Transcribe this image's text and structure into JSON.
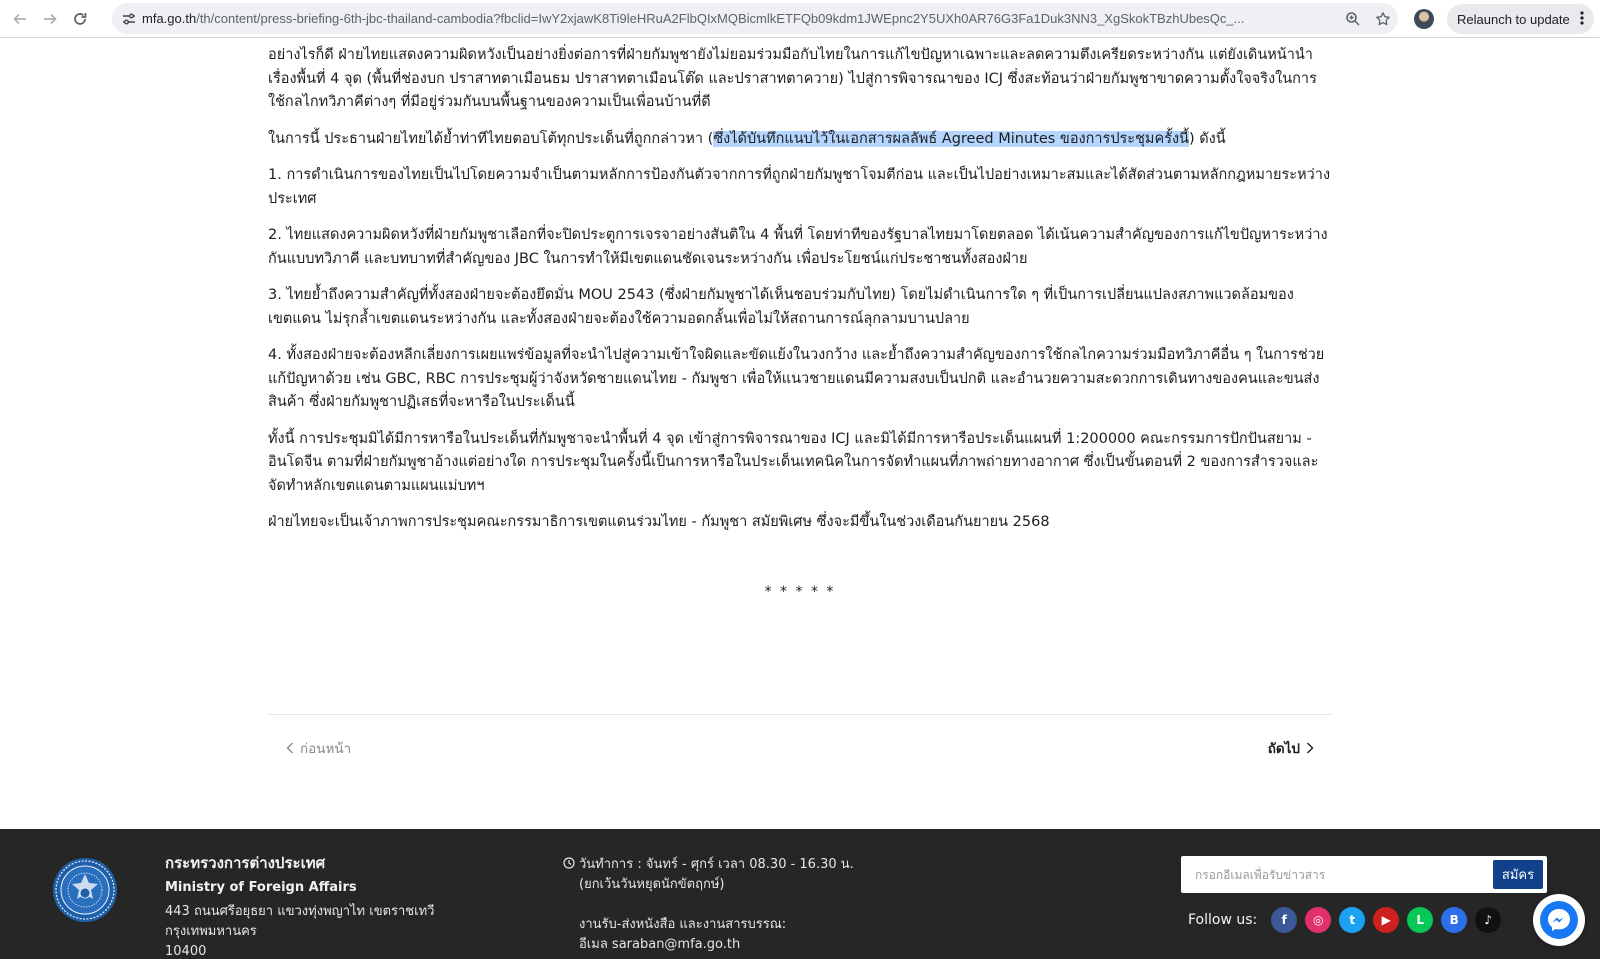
{
  "browser": {
    "url_host": "mfa.go.th",
    "url_path": "/th/content/press-briefing-6th-jbc-thailand-cambodia?fbclid=IwY2xjawK8Ti9leHRuA2FlbQIxMQBicmlkETFQb09kdm1JWEpnc2Y5UXh0AR76G3Fa1Duk3NN3_XgSkokTBzhUbesQc_...",
    "relaunch_label": "Relaunch to update"
  },
  "article": {
    "p_intro": "อย่างไรก็ดี ฝ่ายไทยแสดงความผิดหวังเป็นอย่างยิ่งต่อการที่ฝ่ายกัมพูชายังไม่ยอมร่วมมือกับไทยในการแก้ไขปัญหาเฉพาะและลดความตึงเครียดระหว่างกัน แต่ยังเดินหน้านำเรื่องพื้นที่ 4 จุด (พื้นที่ช่องบก ปราสาทตาเมือนธม ปราสาทตาเมือนโต๊ด และปราสาทตาควาย) ไปสู่การพิจารณาของ ICJ ซึ่งสะท้อนว่าฝ่ายกัมพูชาขาดความตั้งใจจริงในการใช้กลไกทวิภาคีต่างๆ ที่มีอยู่ร่วมกันบนพื้นฐานของความเป็นเพื่อนบ้านที่ดี",
    "p_lead_before": "ในการนี้ ประธานฝ่ายไทยได้ย้ำท่าทีไทยตอบโต้ทุกประเด็นที่ถูกกล่าวหา (",
    "p_lead_highlight": "ซึ่งได้บันทึกแนบไว้ในเอกสารผลลัพธ์ Agreed Minutes ของการประชุมครั้งนี้",
    "p_lead_after": ") ดังนี้",
    "items": [
      "1. การดำเนินการของไทยเป็นไปโดยความจำเป็นตามหลักการป้องกันตัวจากการที่ถูกฝ่ายกัมพูชาโจมตีก่อน และเป็นไปอย่างเหมาะสมและได้สัดส่วนตามหลักกฎหมายระหว่างประเทศ",
      "2. ไทยแสดงความผิดหวังที่ฝ่ายกัมพูชาเลือกที่จะปิดประตูการเจรจาอย่างสันติใน 4 พื้นที่ โดยท่าทีของรัฐบาลไทยมาโดยตลอด ได้เน้นความสำคัญของการแก้ไขปัญหาระหว่างกันแบบทวิภาคี และบทบาทที่สำคัญของ JBC ในการทำให้มีเขตแดนชัดเจนระหว่างกัน เพื่อประโยชน์แก่ประชาชนทั้งสองฝ่าย",
      "3. ไทยย้ำถึงความสำคัญที่ทั้งสองฝ่ายจะต้องยึดมั่น MOU 2543 (ซึ่งฝ่ายกัมพูชาได้เห็นชอบร่วมกับไทย) โดยไม่ดำเนินการใด ๆ ที่เป็นการเปลี่ยนแปลงสภาพแวดล้อมของเขตแดน ไม่รุกล้ำเขตแดนระหว่างกัน และทั้งสองฝ่ายจะต้องใช้ความอดกลั้นเพื่อไม่ให้สถานการณ์ลุกลามบานปลาย",
      "4. ทั้งสองฝ่ายจะต้องหลีกเลี่ยงการเผยแพร่ข้อมูลที่จะนำไปสู่ความเข้าใจผิดและขัดแย้งในวงกว้าง และย้ำถึงความสำคัญของการใช้กลไกความร่วมมือทวิภาคีอื่น ๆ ในการช่วยแก้ปัญหาด้วย เช่น GBC, RBC การประชุมผู้ว่าจังหวัดชายแดนไทย - กัมพูชา เพื่อให้แนวชายแดนมีความสงบเป็นปกติ และอำนวยความสะดวกการเดินทางของคนและขนส่งสินค้า ซึ่งฝ่ายกัมพูชาปฏิเสธที่จะหารือในประเด็นนี้"
    ],
    "p_note": "ทั้งนี้ การประชุมมิได้มีการหารือในประเด็นที่กัมพูชาจะนำพื้นที่ 4 จุด เข้าสู่การพิจารณาของ ICJ และมิได้มีการหารือประเด็นแผนที่ 1:200000 คณะกรรมการปักปันสยาม - อินโดจีน ตามที่ฝ่ายกัมพูชาอ้างแต่อย่างใด การประชุมในครั้งนี้เป็นการหารือในประเด็นเทคนิคในการจัดทำแผนที่ภาพถ่ายทางอากาศ ซึ่งเป็นขั้นตอนที่ 2 ของการสำรวจและจัดทำหลักเขตแดนตามแผนแม่บทฯ",
    "p_final": "ฝ่ายไทยจะเป็นเจ้าภาพการประชุมคณะกรรมาธิการเขตแดนร่วมไทย - กัมพูชา สมัยพิเศษ ซึ่งจะมีขึ้นในช่วงเดือนกันยายน 2568",
    "stars": "* * * * *"
  },
  "pager": {
    "prev_label": "ก่อนหน้า",
    "next_label": "ถัดไป"
  },
  "footer": {
    "org_th": "กระทรวงการต่างประเทศ",
    "org_en": "Ministry of Foreign Affairs",
    "address_line1": "443 ถนนศรีอยุธยา แขวงทุ่งพญาไท เขตราชเทวี กรุงเทพมหานคร",
    "address_line2": "10400",
    "hours_line1": "วันทำการ : จันทร์ - ศุกร์ เวลา 08.30 - 16.30 น.",
    "hours_line2": "(ยกเว้นวันหยุดนักขัตฤกษ์)",
    "docs_line1": "งานรับ-ส่งหนังสือ และงานสารบรรณ:",
    "docs_line2": "อีเมล saraban@mfa.go.th",
    "email_placeholder": "กรอกอีเมลเพื่อรับข่าวสาร",
    "subscribe_label": "สมัคร",
    "follow_label": "Follow us:",
    "social": [
      {
        "name": "facebook-icon",
        "glyph": "f",
        "color": "#3b5998"
      },
      {
        "name": "instagram-icon",
        "glyph": "◎",
        "color": "#e1306c"
      },
      {
        "name": "twitter-icon",
        "glyph": "t",
        "color": "#1da1f2"
      },
      {
        "name": "youtube-icon",
        "glyph": "▶",
        "color": "#cd201f"
      },
      {
        "name": "line-icon",
        "glyph": "L",
        "color": "#06c755"
      },
      {
        "name": "blockdit-icon",
        "glyph": "B",
        "color": "#2c6fe8"
      },
      {
        "name": "tiktok-icon",
        "glyph": "♪",
        "color": "#111111"
      }
    ]
  }
}
